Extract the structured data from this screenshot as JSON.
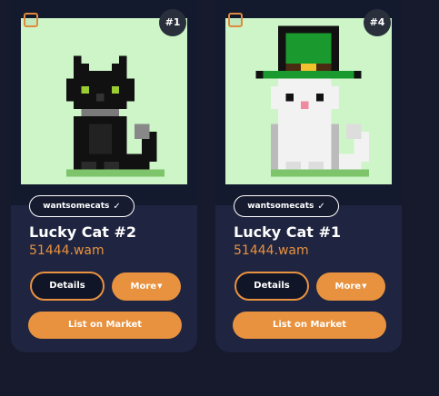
{
  "cards": [
    {
      "rank": "#1",
      "collection": "wantsomecats",
      "name": "Lucky Cat #2",
      "owner": "51444.wam",
      "details_label": "Details",
      "more_label": "More",
      "list_label": "List on Market",
      "art": "black-cat"
    },
    {
      "rank": "#4",
      "collection": "wantsomecats",
      "name": "Lucky Cat #1",
      "owner": "51444.wam",
      "details_label": "Details",
      "more_label": "More",
      "list_label": "List on Market",
      "art": "white-cat-leprechaun-hat"
    }
  ],
  "colors": {
    "accent": "#e8923f",
    "card_bg": "#1f2440",
    "page_bg": "#161a2c",
    "art_bg": "#cdf5c8"
  }
}
